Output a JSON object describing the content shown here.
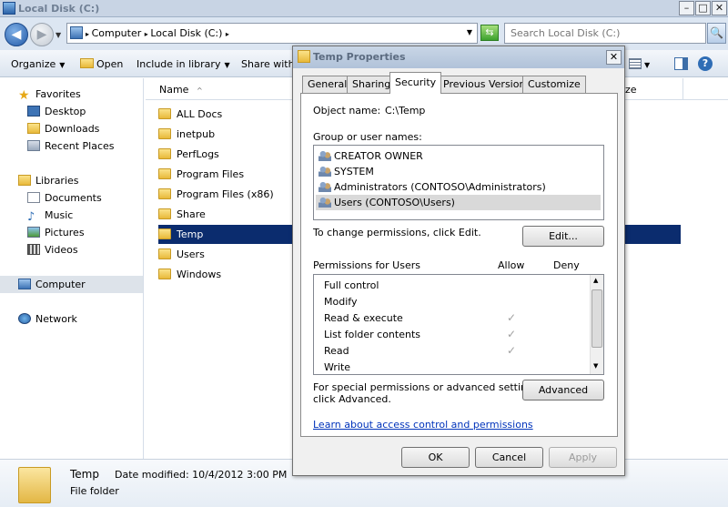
{
  "window": {
    "title": "Local Disk (C:)",
    "minimize": "–",
    "maximize": "□",
    "close": "✕"
  },
  "address": {
    "crumb1": "Computer",
    "crumb2": "Local Disk (C:)",
    "search_placeholder": "Search Local Disk (C:)"
  },
  "toolbar": {
    "organize": "Organize",
    "open": "Open",
    "include": "Include in library",
    "share": "Share with"
  },
  "nav": {
    "favorites": "Favorites",
    "desktop": "Desktop",
    "downloads": "Downloads",
    "recent": "Recent Places",
    "libraries": "Libraries",
    "documents": "Documents",
    "music": "Music",
    "pictures": "Pictures",
    "videos": "Videos",
    "computer": "Computer",
    "network": "Network"
  },
  "files": {
    "column_name": "Name",
    "column_size_fragment": "ze",
    "items": [
      "ALL Docs",
      "inetpub",
      "PerfLogs",
      "Program Files",
      "Program Files (x86)",
      "Share",
      "Temp",
      "Users",
      "Windows"
    ],
    "selected": "Temp"
  },
  "details": {
    "name": "Temp",
    "date_modified": "Date modified: 10/4/2012 3:00 PM",
    "type": "File folder"
  },
  "dialog": {
    "title": "Temp Properties",
    "tabs": [
      "General",
      "Sharing",
      "Security",
      "Previous Versions",
      "Customize"
    ],
    "active_tab": "Security",
    "object_name_label": "Object name:",
    "object_name_value": "C:\\Temp",
    "group_label": "Group or user names:",
    "groups": [
      "CREATOR OWNER",
      "SYSTEM",
      "Administrators (CONTOSO\\Administrators)",
      "Users (CONTOSO\\Users)"
    ],
    "selected_group": "Users (CONTOSO\\Users)",
    "change_text": "To change permissions, click Edit.",
    "edit_button": "Edit...",
    "perm_label": "Permissions for Users",
    "allow_label": "Allow",
    "deny_label": "Deny",
    "permissions": [
      {
        "name": "Full control",
        "allow": false
      },
      {
        "name": "Modify",
        "allow": false
      },
      {
        "name": "Read & execute",
        "allow": true
      },
      {
        "name": "List folder contents",
        "allow": true
      },
      {
        "name": "Read",
        "allow": true
      },
      {
        "name": "Write",
        "allow": false
      }
    ],
    "check_glyph": "✓",
    "special_text_1": "For special permissions or advanced settings,",
    "special_text_2": "click Advanced.",
    "advanced_button": "Advanced",
    "learn_link": "Learn about access control and permissions",
    "ok": "OK",
    "cancel": "Cancel",
    "apply": "Apply"
  },
  "icons": {
    "back": "◀",
    "forward": "▶",
    "drop": "▼",
    "search": "🔍",
    "refresh": "⇆"
  }
}
